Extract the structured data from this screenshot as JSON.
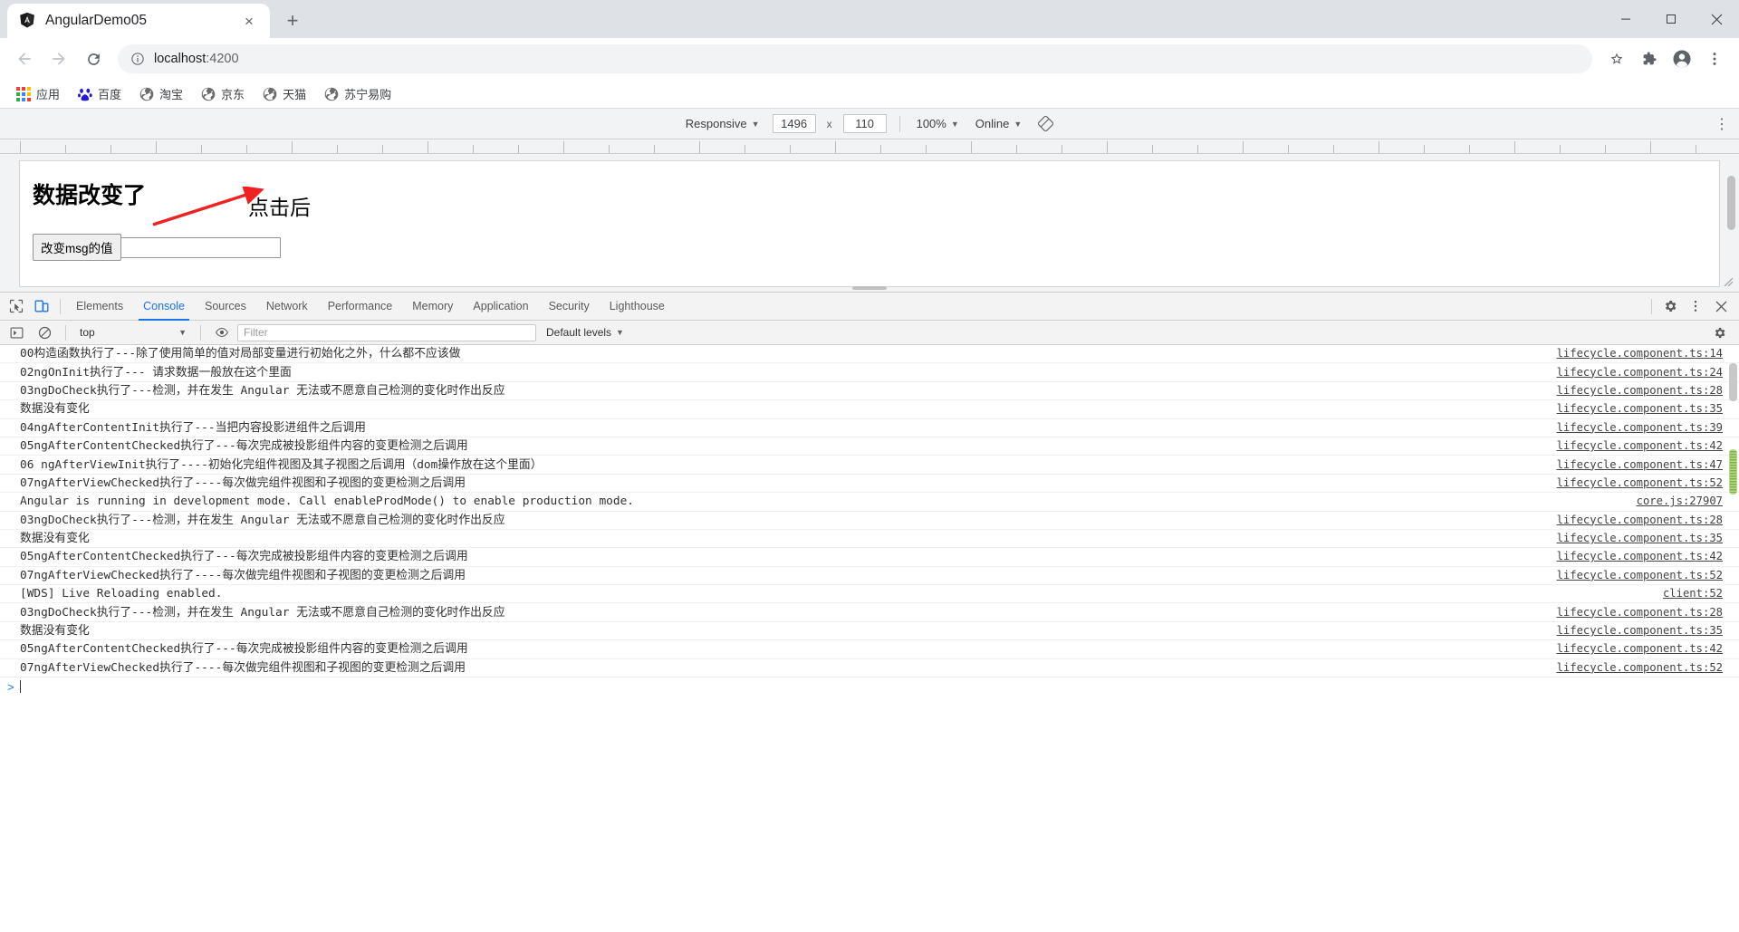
{
  "window": {
    "minimize_label": "Minimize",
    "maximize_label": "Maximize",
    "close_label": "Close"
  },
  "tab": {
    "title": "AngularDemo05",
    "favicon": "angular-icon",
    "close_label": "×",
    "new_tab_label": "+"
  },
  "toolbar": {
    "back_label": "Back",
    "forward_label": "Forward",
    "reload_label": "Reload",
    "url_host": "localhost",
    "url_port": ":4200",
    "site_info_label": "View site information",
    "bookmark_label": "Bookmark this tab",
    "extensions_label": "Extensions",
    "profile_label": "Profile",
    "menu_label": "Customize and control Google Chrome"
  },
  "bookmarks": [
    {
      "label": "应用",
      "icon": "apps-grid-icon"
    },
    {
      "label": "百度",
      "icon": "baidu-icon"
    },
    {
      "label": "淘宝",
      "icon": "globe-icon"
    },
    {
      "label": "京东",
      "icon": "globe-icon"
    },
    {
      "label": "天猫",
      "icon": "globe-icon"
    },
    {
      "label": "苏宁易购",
      "icon": "globe-icon"
    }
  ],
  "device_toolbar": {
    "device": "Responsive",
    "width": "1496",
    "height": "110",
    "separator": "x",
    "zoom": "100%",
    "throttling": "Online",
    "rotate_label": "Rotate",
    "more_label": "More options"
  },
  "page": {
    "heading": "数据改变了",
    "button_label": "改变msg的值",
    "input_value": "",
    "annotation": "点击后",
    "annotation_color": "#ee2222"
  },
  "devtools": {
    "inspect_label": "Inspect element",
    "device_toggle_label": "Toggle device toolbar",
    "tabs": [
      "Elements",
      "Console",
      "Sources",
      "Network",
      "Performance",
      "Memory",
      "Application",
      "Security",
      "Lighthouse"
    ],
    "active_tab": "Console",
    "settings_label": "Settings",
    "more_label": "More options",
    "close_label": "Close DevTools",
    "accent_color": "#1a73e8"
  },
  "console": {
    "execute_label": "Execute",
    "clear_label": "Clear console",
    "context": "top",
    "live_expression_label": "Create live expression",
    "filter_placeholder": "Filter",
    "filter_value": "",
    "levels": "Default levels",
    "settings_label": "Console settings",
    "prompt_caret": ">",
    "messages": [
      {
        "text": "00构造函数执行了---除了使用简单的值对局部变量进行初始化之外，什么都不应该做",
        "source": "lifecycle.component.ts:14"
      },
      {
        "text": "02ngOnInit执行了--- 请求数据一般放在这个里面",
        "source": "lifecycle.component.ts:24"
      },
      {
        "text": "03ngDoCheck执行了---检测，并在发生 Angular 无法或不愿意自己检测的变化时作出反应",
        "source": "lifecycle.component.ts:28"
      },
      {
        "text": "数据没有变化",
        "source": "lifecycle.component.ts:35"
      },
      {
        "text": "04ngAfterContentInit执行了---当把内容投影进组件之后调用",
        "source": "lifecycle.component.ts:39"
      },
      {
        "text": "05ngAfterContentChecked执行了---每次完成被投影组件内容的变更检测之后调用",
        "source": "lifecycle.component.ts:42"
      },
      {
        "text": "06 ngAfterViewInit执行了----初始化完组件视图及其子视图之后调用（dom操作放在这个里面）",
        "source": "lifecycle.component.ts:47"
      },
      {
        "text": "07ngAfterViewChecked执行了----每次做完组件视图和子视图的变更检测之后调用",
        "source": "lifecycle.component.ts:52"
      },
      {
        "text": "Angular is running in development mode. Call enableProdMode() to enable production mode.",
        "source": "core.js:27907"
      },
      {
        "text": "03ngDoCheck执行了---检测，并在发生 Angular 无法或不愿意自己检测的变化时作出反应",
        "source": "lifecycle.component.ts:28"
      },
      {
        "text": "数据没有变化",
        "source": "lifecycle.component.ts:35"
      },
      {
        "text": "05ngAfterContentChecked执行了---每次完成被投影组件内容的变更检测之后调用",
        "source": "lifecycle.component.ts:42"
      },
      {
        "text": "07ngAfterViewChecked执行了----每次做完组件视图和子视图的变更检测之后调用",
        "source": "lifecycle.component.ts:52"
      },
      {
        "text": "[WDS] Live Reloading enabled.",
        "source": "client:52"
      },
      {
        "text": "03ngDoCheck执行了---检测，并在发生 Angular 无法或不愿意自己检测的变化时作出反应",
        "source": "lifecycle.component.ts:28"
      },
      {
        "text": "数据没有变化",
        "source": "lifecycle.component.ts:35"
      },
      {
        "text": "05ngAfterContentChecked执行了---每次完成被投影组件内容的变更检测之后调用",
        "source": "lifecycle.component.ts:42"
      },
      {
        "text": "07ngAfterViewChecked执行了----每次做完组件视图和子视图的变更检测之后调用",
        "source": "lifecycle.component.ts:52"
      }
    ]
  }
}
